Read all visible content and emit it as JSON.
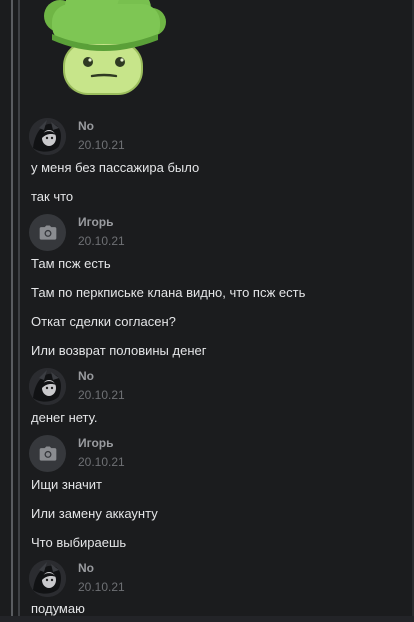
{
  "messages": [
    {
      "author": "No",
      "date": "20.10.21",
      "text": [
        "у меня без пассажира было",
        "так что"
      ]
    },
    {
      "author": "Игорь",
      "date": "20.10.21",
      "text": [
        "Там псж есть",
        "Там по перкпиське клана видно, что псж есть",
        "Откат сделки согласен?",
        "Или возврат половины денег"
      ]
    },
    {
      "author": "No",
      "date": "20.10.21",
      "text": [
        "денег нету."
      ]
    },
    {
      "author": "Игорь",
      "date": "20.10.21",
      "text": [
        "Ищи значит",
        "Или замену аккаунту",
        "Что выбираешь"
      ]
    },
    {
      "author": "No",
      "date": "20.10.21",
      "text": [
        "подумаю"
      ]
    }
  ],
  "icons": {
    "sticker": "broccoli-sticker-icon",
    "avatar_no": "avatar-icon",
    "avatar_igor": "camera-icon"
  },
  "colors": {
    "background": "#1b1c1e",
    "text": "#e4e5e7",
    "author": "#9a9ca0",
    "date": "#6e7074"
  }
}
